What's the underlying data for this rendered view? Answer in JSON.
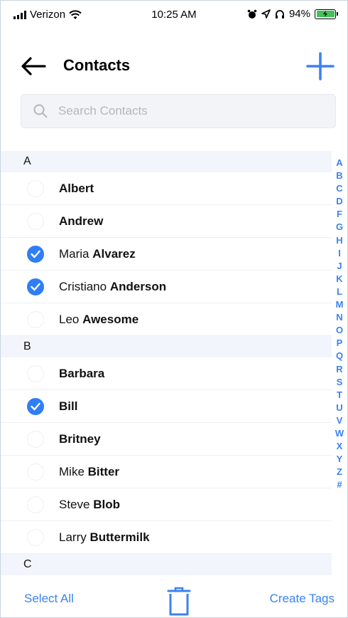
{
  "status_bar": {
    "carrier": "Verizon",
    "time": "10:25 AM",
    "battery_percent": "94%",
    "battery_color": "#41c35a"
  },
  "header": {
    "title": "Contacts",
    "back_icon": "arrow-left-icon",
    "add_icon": "plus-icon",
    "accent": "#3b82f0"
  },
  "search": {
    "placeholder": "Search Contacts",
    "value": ""
  },
  "sections": [
    {
      "letter": "A",
      "contacts": [
        {
          "first": "",
          "last": "Albert",
          "selected": false
        },
        {
          "first": "",
          "last": "Andrew",
          "selected": false
        },
        {
          "first": "Maria ",
          "last": "Alvarez",
          "selected": true
        },
        {
          "first": "Cristiano ",
          "last": "Anderson",
          "selected": true
        },
        {
          "first": "Leo ",
          "last": "Awesome",
          "selected": false
        }
      ]
    },
    {
      "letter": "B",
      "contacts": [
        {
          "first": "",
          "last": "Barbara",
          "selected": false
        },
        {
          "first": "",
          "last": "Bill",
          "selected": true
        },
        {
          "first": "",
          "last": "Britney",
          "selected": false
        },
        {
          "first": "Mike ",
          "last": "Bitter",
          "selected": false
        },
        {
          "first": "Steve ",
          "last": "Blob",
          "selected": false
        },
        {
          "first": "Larry ",
          "last": "Buttermilk",
          "selected": false
        }
      ]
    },
    {
      "letter": "C",
      "contacts": []
    }
  ],
  "alpha_index": [
    "A",
    "B",
    "C",
    "D",
    "F",
    "G",
    "H",
    "I",
    "J",
    "K",
    "L",
    "M",
    "N",
    "O",
    "P",
    "Q",
    "R",
    "S",
    "T",
    "U",
    "V",
    "W",
    "X",
    "Y",
    "Z",
    "#"
  ],
  "bottom_bar": {
    "select_all": "Select All",
    "create_tags": "Create Tags",
    "trash_icon": "trash-icon"
  }
}
